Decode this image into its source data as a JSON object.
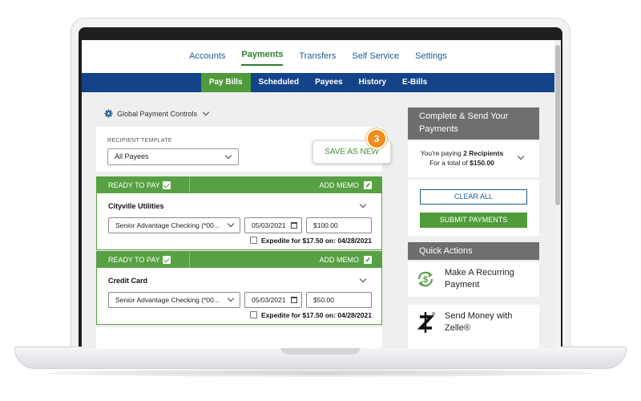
{
  "nav": {
    "items": [
      "Accounts",
      "Payments",
      "Transfers",
      "Self Service",
      "Settings"
    ],
    "active": "Payments"
  },
  "subnav": {
    "items": [
      "Pay Bills",
      "Scheduled",
      "Payees",
      "History",
      "E-Bills"
    ],
    "active": "Pay Bills"
  },
  "controls": {
    "global_payment_controls": "Global Payment Controls"
  },
  "template": {
    "label": "RECIPIENT TEMPLATE",
    "selected": "All Payees",
    "save_as_new": "SAVE AS NEW",
    "callout_number": "3"
  },
  "payments": [
    {
      "header": "READY TO PAY",
      "memo": "ADD MEMO",
      "payee": "Cityville Utilities",
      "account": "Senior Advantage Checking (*00...",
      "date": "05/03/2021",
      "amount": "$100.00",
      "expedite": "Expedite for $17.50 on: 04/28/2021"
    },
    {
      "header": "READY TO PAY",
      "memo": "ADD MEMO",
      "payee": "Credit Card",
      "account": "Senior Advantage Checking (*00...",
      "date": "05/03/2021",
      "amount": "$50.00",
      "expedite": "Expedite for $17.50 on: 04/28/2021"
    }
  ],
  "summary": {
    "title": "Complete & Send Your Payments",
    "paying_prefix": "You're paying",
    "paying_count": "2 Recipients",
    "total_prefix": "For a total of",
    "total": "$150.00",
    "clear_all": "CLEAR ALL",
    "submit": "SUBMIT PAYMENTS"
  },
  "quick_actions": {
    "title": "Quick Actions",
    "items": [
      {
        "label": "Make A Recurring Payment",
        "icon": "recurring-dollar-icon"
      },
      {
        "label": "Send Money with Zelle®",
        "icon": "zelle-logo-icon"
      }
    ]
  },
  "colors": {
    "brand_blue": "#14438a",
    "brand_green": "#57a043",
    "accent_orange": "#f28c1a",
    "panel_gray": "#6d6e70"
  }
}
